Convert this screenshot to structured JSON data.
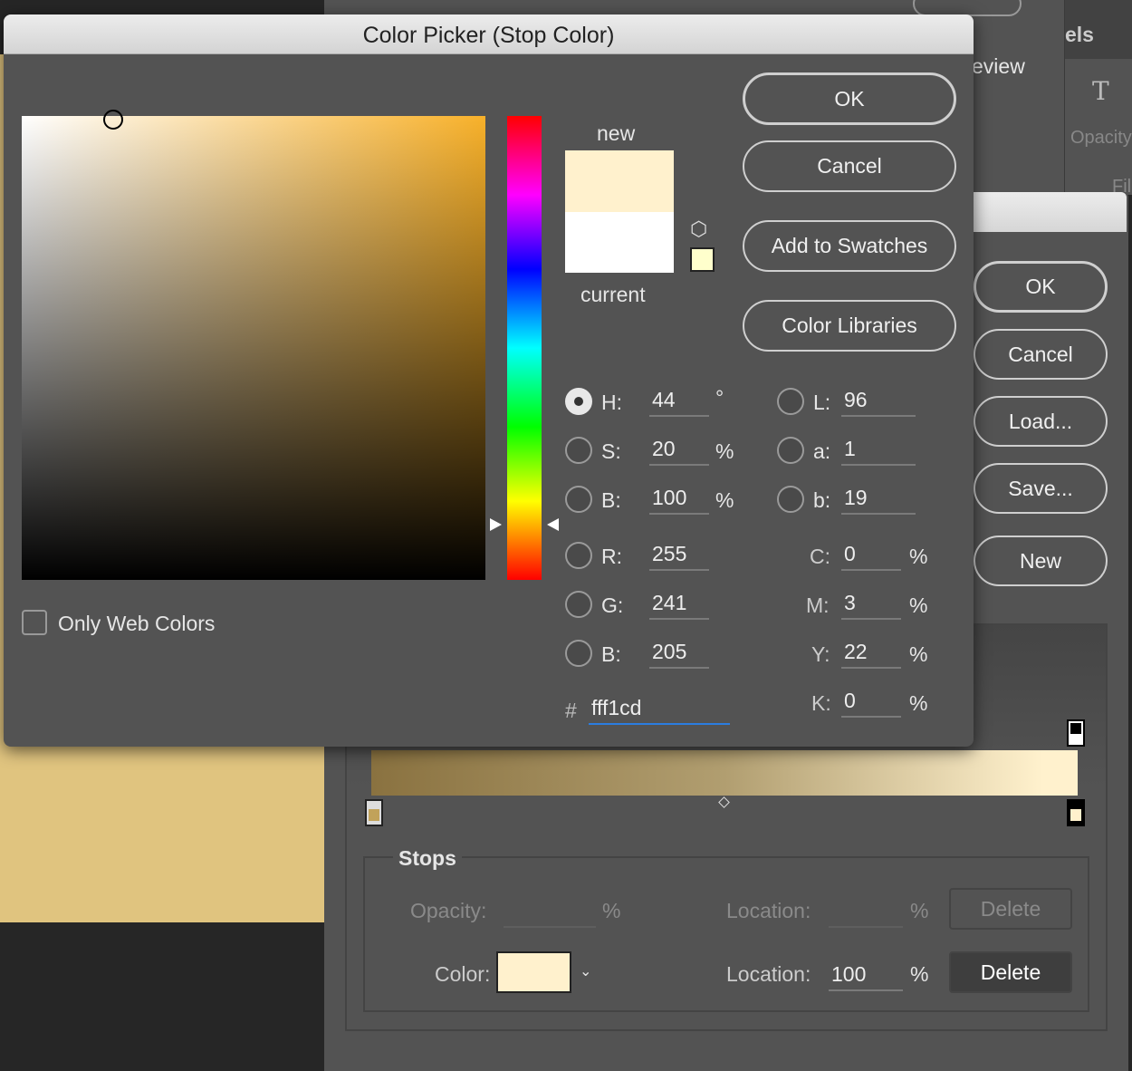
{
  "background_window": {
    "preview_label": "eview",
    "panel_tab": "els",
    "type_icon": "T",
    "opacity_label": "Opacity",
    "fill_label": "Fil"
  },
  "gradient_editor": {
    "buttons": {
      "ok": "OK",
      "cancel": "Cancel",
      "load": "Load...",
      "save": "Save...",
      "new": "New"
    },
    "gradient": {
      "start_color": "#c1a25a",
      "end_color": "#fff1cd"
    },
    "stops": {
      "title": "Stops",
      "opacity_label": "Opacity:",
      "opacity_value": "",
      "percent": "%",
      "location_label": "Location:",
      "location_opacity_value": "",
      "delete_label": "Delete",
      "color_label": "Color:",
      "color_value": "#fff1cd",
      "location_value": "100"
    }
  },
  "color_picker": {
    "title": "Color Picker (Stop Color)",
    "new_label": "new",
    "current_label": "current",
    "new_color": "#fff1cd",
    "current_color": "#ffffff",
    "buttons": {
      "ok": "OK",
      "cancel": "Cancel",
      "add_to_swatches": "Add to Swatches",
      "color_libraries": "Color Libraries"
    },
    "only_web_colors": "Only Web Colors",
    "hsb": [
      {
        "label": "H:",
        "value": "44",
        "unit": "°",
        "selected": true
      },
      {
        "label": "S:",
        "value": "20",
        "unit": "%"
      },
      {
        "label": "B:",
        "value": "100",
        "unit": "%"
      }
    ],
    "rgb": [
      {
        "label": "R:",
        "value": "255"
      },
      {
        "label": "G:",
        "value": "241"
      },
      {
        "label": "B:",
        "value": "205"
      }
    ],
    "lab": [
      {
        "label": "L:",
        "value": "96"
      },
      {
        "label": "a:",
        "value": "1"
      },
      {
        "label": "b:",
        "value": "19"
      }
    ],
    "cmyk": [
      {
        "label": "C:",
        "value": "0",
        "unit": "%"
      },
      {
        "label": "M:",
        "value": "3",
        "unit": "%"
      },
      {
        "label": "Y:",
        "value": "22",
        "unit": "%"
      },
      {
        "label": "K:",
        "value": "0",
        "unit": "%"
      }
    ],
    "hex_label": "#",
    "hex_value": "fff1cd"
  }
}
